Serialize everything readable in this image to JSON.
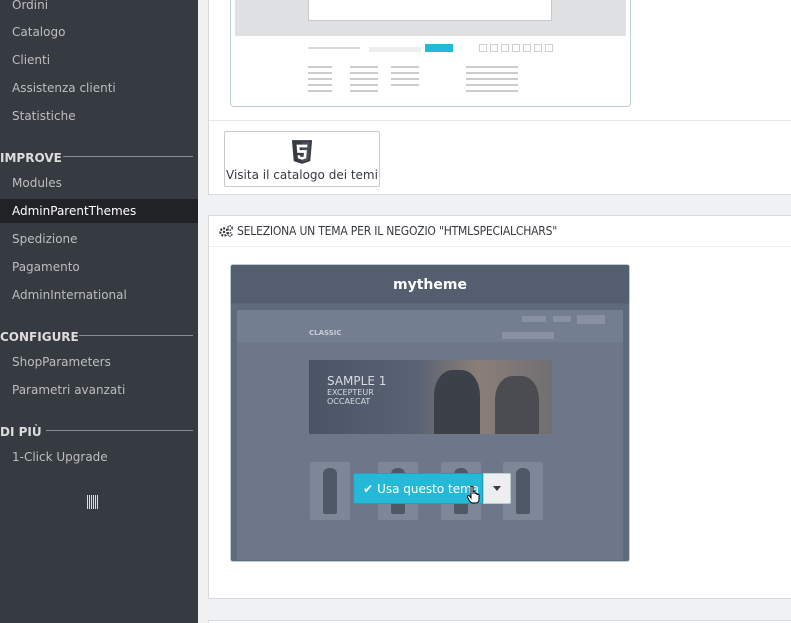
{
  "sidebar": {
    "items_top": [
      "Ordini",
      "Catalogo",
      "Clienti",
      "Assistenza clienti",
      "Statistiche"
    ],
    "section_improve": "IMPROVE",
    "items_improve": [
      "Modules",
      "AdminParentThemes",
      "Spedizione",
      "Pagamento",
      "AdminInternational"
    ],
    "section_configure": "CONFIGURE",
    "items_configure": [
      "ShopParameters",
      "Parametri avanzati"
    ],
    "section_more": "DI PIÙ",
    "items_more": [
      "1-Click Upgrade"
    ],
    "active_item": "AdminParentThemes",
    "collapse_icon": "collapse-sidebar-icon"
  },
  "catalog": {
    "button_label": "Visita il catalogo dei temi",
    "icon": "html5-icon"
  },
  "select_theme": {
    "heading": "SELEZIONA UN TEMA PER IL NEGOZIO \"HTMLSPECIALCHARS\"",
    "icon": "cogs-icon",
    "theme_name": "mytheme",
    "banner_title": "SAMPLE 1",
    "banner_sub1": "EXCEPTEUR",
    "banner_sub2": "OCCAECAT",
    "shop_name": "CLASSIC",
    "use_button": "Usa questo tema"
  },
  "colors": {
    "sidebar_bg": "#363a41",
    "active_bg": "#202226",
    "accent": "#25b9d7",
    "theme_header": "#545e6f"
  }
}
